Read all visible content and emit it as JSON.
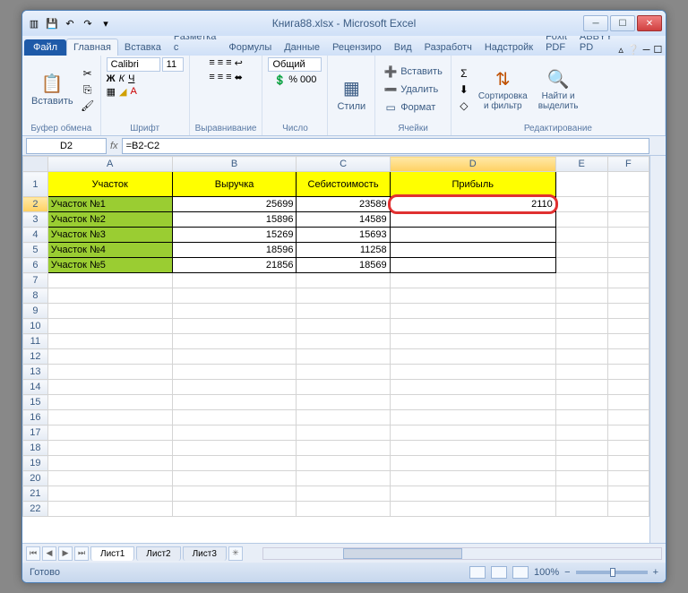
{
  "title": "Книга88.xlsx - Microsoft Excel",
  "qat": {
    "save": "💾",
    "undo": "↶",
    "redo": "↷"
  },
  "file_tab": "Файл",
  "tabs": [
    "Главная",
    "Вставка",
    "Разметка с",
    "Формулы",
    "Данные",
    "Рецензиро",
    "Вид",
    "Разработч",
    "Надстройк",
    "Foxit PDF",
    "ABBYY PD"
  ],
  "ribbon": {
    "clipboard": {
      "label": "Буфер обмена",
      "paste": "Вставить"
    },
    "font": {
      "label": "Шрифт",
      "name": "Calibri",
      "size": "11"
    },
    "align": {
      "label": "Выравнивание"
    },
    "number": {
      "label": "Число",
      "format": "Общий"
    },
    "styles": {
      "label": "Стили",
      "btn": "Стили"
    },
    "cells": {
      "label": "Ячейки",
      "insert": "Вставить",
      "delete": "Удалить",
      "format": "Формат"
    },
    "editing": {
      "label": "Редактирование",
      "sort": "Сортировка\nи фильтр",
      "find": "Найти и\nвыделить"
    }
  },
  "namebox": "D2",
  "formula": "=B2-C2",
  "columns": [
    "A",
    "B",
    "C",
    "D",
    "E",
    "F"
  ],
  "rows": [
    "1",
    "2",
    "3",
    "4",
    "5",
    "6",
    "7",
    "8",
    "9",
    "10",
    "11",
    "12",
    "13",
    "14",
    "15",
    "16",
    "17",
    "18",
    "19",
    "20",
    "21",
    "22"
  ],
  "headers": {
    "a": "Участок",
    "b": "Выручка",
    "c": "Себистоимость",
    "d": "Прибыль"
  },
  "data": [
    {
      "a": "Участок №1",
      "b": "25699",
      "c": "23589",
      "d": "2110"
    },
    {
      "a": "Участок №2",
      "b": "15896",
      "c": "14589",
      "d": ""
    },
    {
      "a": "Участок №3",
      "b": "15269",
      "c": "15693",
      "d": ""
    },
    {
      "a": "Участок №4",
      "b": "18596",
      "c": "11258",
      "d": ""
    },
    {
      "a": "Участок №5",
      "b": "21856",
      "c": "18569",
      "d": ""
    }
  ],
  "sheets": [
    "Лист1",
    "Лист2",
    "Лист3"
  ],
  "status": "Готово",
  "zoom": "100%"
}
